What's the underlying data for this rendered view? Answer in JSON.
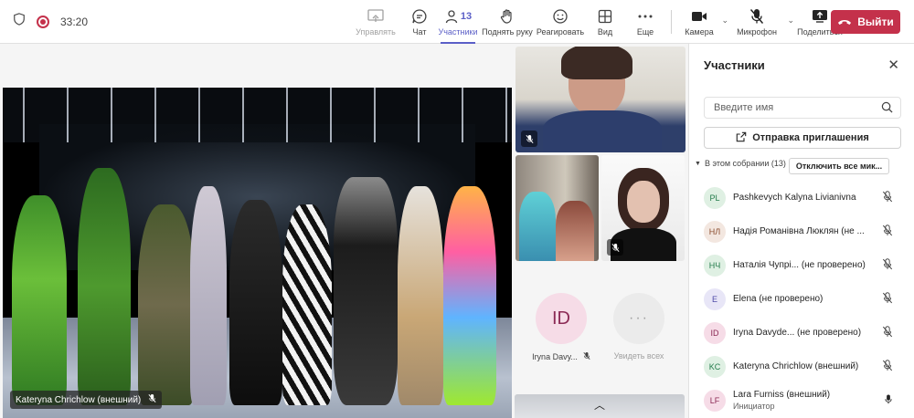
{
  "topbar": {
    "timer": "33:20",
    "buttons": [
      {
        "label": "Управлять",
        "icon": "share-screen-icon"
      },
      {
        "label": "Чат",
        "icon": "chat-icon"
      },
      {
        "label": "Участники",
        "icon": "people-icon",
        "count": "13"
      },
      {
        "label": "Поднять руку",
        "icon": "raise-hand-icon"
      },
      {
        "label": "Реагировать",
        "icon": "smiley-icon"
      },
      {
        "label": "Вид",
        "icon": "grid-icon"
      },
      {
        "label": "Еще",
        "icon": "more-icon"
      }
    ],
    "devices": [
      {
        "label": "Камера",
        "icon": "camera-icon"
      },
      {
        "label": "Микрофон",
        "icon": "mic-off-icon"
      },
      {
        "label": "Поделиться",
        "icon": "share-icon"
      }
    ],
    "leave_label": "Выйти"
  },
  "stage": {
    "presenter_tag": "Kateryna Chrichlow (внешний)",
    "tiles": [
      {
        "name": "Iryna Davy...",
        "initials": "ID"
      },
      {
        "name": "Увидеть всех",
        "initials": "···"
      }
    ]
  },
  "panel": {
    "title": "Участники",
    "search_placeholder": "Введите имя",
    "invite_label": "Отправка приглашения",
    "section_label": "В этом собрании (13)",
    "mute_all_label": "Отключить все мик...",
    "participants": [
      {
        "initials": "PL",
        "name": "Pashkevych Kalyna Livianivna",
        "role": "",
        "mic": "off",
        "bg": "#dff0e3",
        "fg": "#237b4b"
      },
      {
        "initials": "НЛ",
        "name": "Надія Романівна Люклян (не ...",
        "role": "",
        "mic": "off",
        "bg": "#f3e7e0",
        "fg": "#8a4b2d"
      },
      {
        "initials": "НЧ",
        "name": "Наталія Чупрі... (не проверено)",
        "role": "",
        "mic": "off",
        "bg": "#dff0e3",
        "fg": "#237b4b"
      },
      {
        "initials": "E",
        "name": "Elena (не проверено)",
        "role": "",
        "mic": "off",
        "bg": "#e8e6f7",
        "fg": "#4f4aa8"
      },
      {
        "initials": "ID",
        "name": "Iryna Davyde...    (не проверено)",
        "role": "",
        "mic": "off",
        "bg": "#f6dce7",
        "fg": "#8b2a55"
      },
      {
        "initials": "KC",
        "name": "Kateryna Chrichlow (внешний)",
        "role": "",
        "mic": "off",
        "bg": "#dff0e3",
        "fg": "#237b4b"
      },
      {
        "initials": "LF",
        "name": "Lara Furniss (внешний)",
        "role": "Инициатор",
        "mic": "on",
        "bg": "#f6dce7",
        "fg": "#8b2a55"
      }
    ]
  }
}
